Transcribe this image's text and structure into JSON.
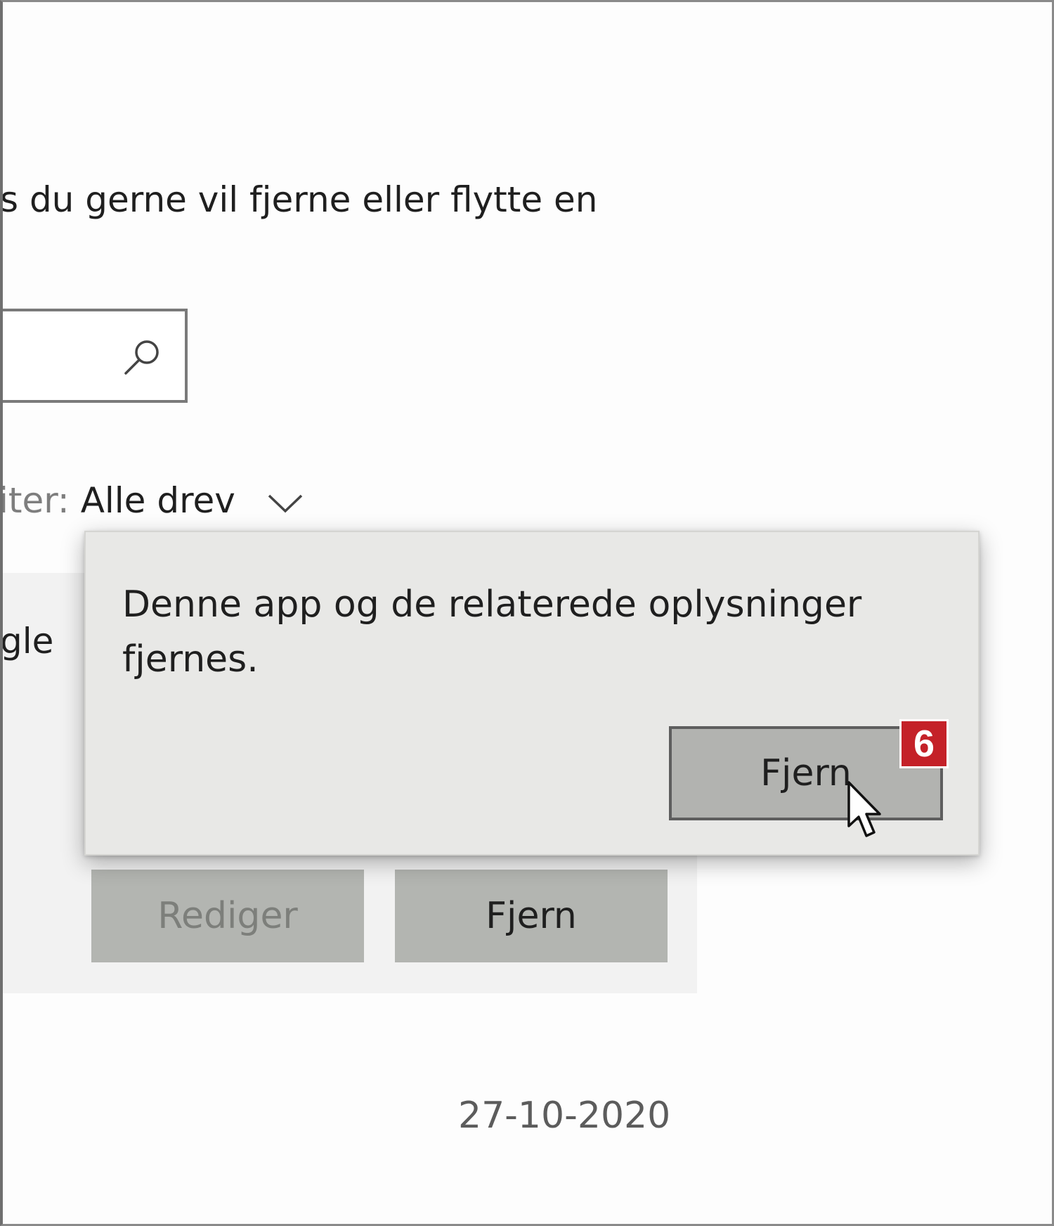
{
  "intro_text": "s du gerne vil fjerne eller flytte en",
  "search": {
    "value": ""
  },
  "filter": {
    "label": "iter:",
    "value": "Alle drev"
  },
  "app": {
    "name_fragment": "gle",
    "edit_label": "Rediger",
    "remove_label": "Fjern",
    "date": "27-10-2020"
  },
  "confirm_popup": {
    "message": "Denne app og de relaterede oplysninger fjernes.",
    "button_label": "Fjern"
  },
  "step_badge": {
    "number": "6",
    "color": "#c42128"
  },
  "icons": [
    "search-icon",
    "chevron-down-icon",
    "mouse-cursor-icon"
  ]
}
